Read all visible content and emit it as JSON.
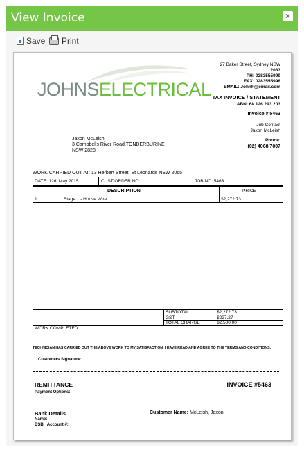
{
  "window": {
    "title": "View Invoice",
    "close_glyph": "×",
    "header_color": "#75c547"
  },
  "toolbar": {
    "save_label": "Save",
    "print_label": "Print",
    "save_icon": "save-icon",
    "print_icon": "print-icon"
  },
  "invoice": {
    "logo": {
      "part1": "JOHNS",
      "part2": "ELECTRICAL",
      "colors": {
        "grey": "#7a8a86",
        "green": "#6abf3a"
      }
    },
    "company": {
      "address1": "27 Baker Street, Sydney NSW",
      "address2": "2033",
      "ph": "PH: 0283555999",
      "fax": "FAX: 0283555998",
      "email": "EMAIL: JohnF@email.com"
    },
    "tax_header": "TAX INVOICE / STATEMENT",
    "abn": "ABN: 68 126 293 203",
    "invoice_no": "Invoice # 5463",
    "job_contact_label": "Job Contact",
    "job_contact_name": "Jaxon McLeish",
    "phone_label": "Phone:",
    "phone_value": "(02) 4068 7007",
    "customer": {
      "name": "Jaxon McLeish",
      "address1": "3 Campbells River Road,TONDERBURINE",
      "address2": "NSW 2828"
    },
    "work_carried_out": "WORK CARRIED OUT AT: 13 Herbert Street, St Leonards NSW 2065",
    "date": "DATE: 12th May 2015",
    "cust_order": "CUST ORDER NO:",
    "job_no": "JOB NO: 5463",
    "col_description": "DESCRIPTION",
    "col_price": "PRICE",
    "line_items": [
      {
        "qty": "1",
        "description": "Stage 1 - House Wire",
        "price": "$2,272.73"
      }
    ],
    "subtotal_label": "SUBTOTAL",
    "subtotal": "$2,272.73",
    "gst_label": "GST",
    "gst": "$227.27",
    "total_label": "TOTAL CHARGE",
    "total": "$2,500.00",
    "work_completed": "WORK COMPLETED:",
    "tech_statement": "TECHNICIAN HAS CARRIED OUT THE ABOVE WORK TO MY SATISFACTION. I HAVE READ AND AGREE TO THE TERMS AND CONDITIONS.",
    "signature_label": "Customers Signature:",
    "remittance": "REMITTANCE",
    "payment_options": "Payment Options:",
    "invoice_big": "INVOICE #5463",
    "bank_details": "Bank Details",
    "name_label": "Name:",
    "bsb_label": "BSB:",
    "account_label": "Account #:",
    "customer_name_label": "Customer Name:",
    "customer_name_value": "McLeish, Jaxon"
  }
}
